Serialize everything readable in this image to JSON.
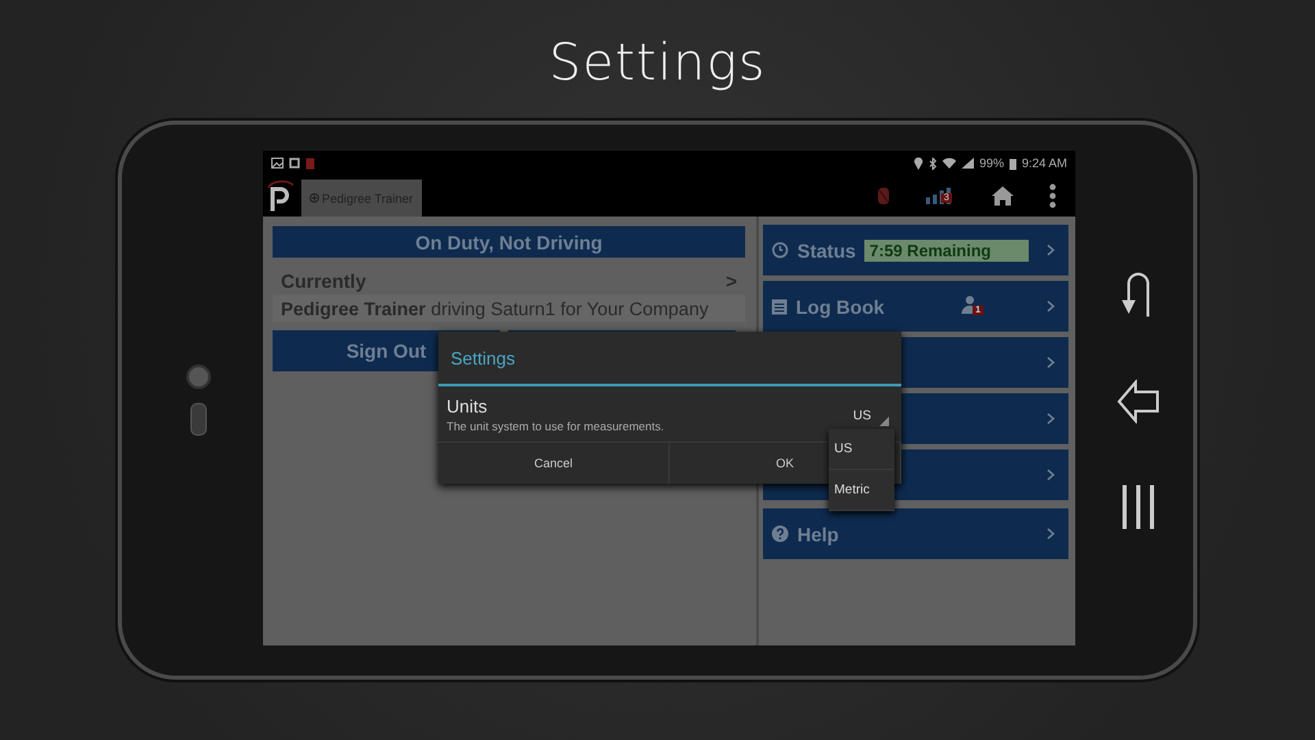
{
  "slide_title": "Settings",
  "status_bar": {
    "battery": "99%",
    "time": "9:24 AM"
  },
  "action_bar": {
    "tab": "Pedigree Trainer",
    "notification_count": "3"
  },
  "duty_status": "On Duty, Not Driving",
  "currently": {
    "label": "Currently",
    "arrow": ">",
    "driver": "Pedigree Trainer",
    "detail": "driving Saturn1 for Your Company"
  },
  "buttons": [
    "Sign Out"
  ],
  "menu": [
    {
      "kind": "status",
      "label": "Status",
      "badge": "7:59 Remaining"
    },
    {
      "kind": "logbook",
      "label": "Log Book",
      "badge": "1"
    },
    {
      "kind": "hidden"
    },
    {
      "kind": "hidden"
    },
    {
      "kind": "hidden"
    },
    {
      "kind": "help",
      "label": "Help"
    }
  ],
  "dialog": {
    "title": "Settings",
    "setting_label": "Units",
    "setting_description": "The unit system to use for measurements.",
    "value": "US",
    "buttons": [
      "Cancel",
      "OK"
    ]
  },
  "dropdown": [
    "US",
    "Metric"
  ]
}
